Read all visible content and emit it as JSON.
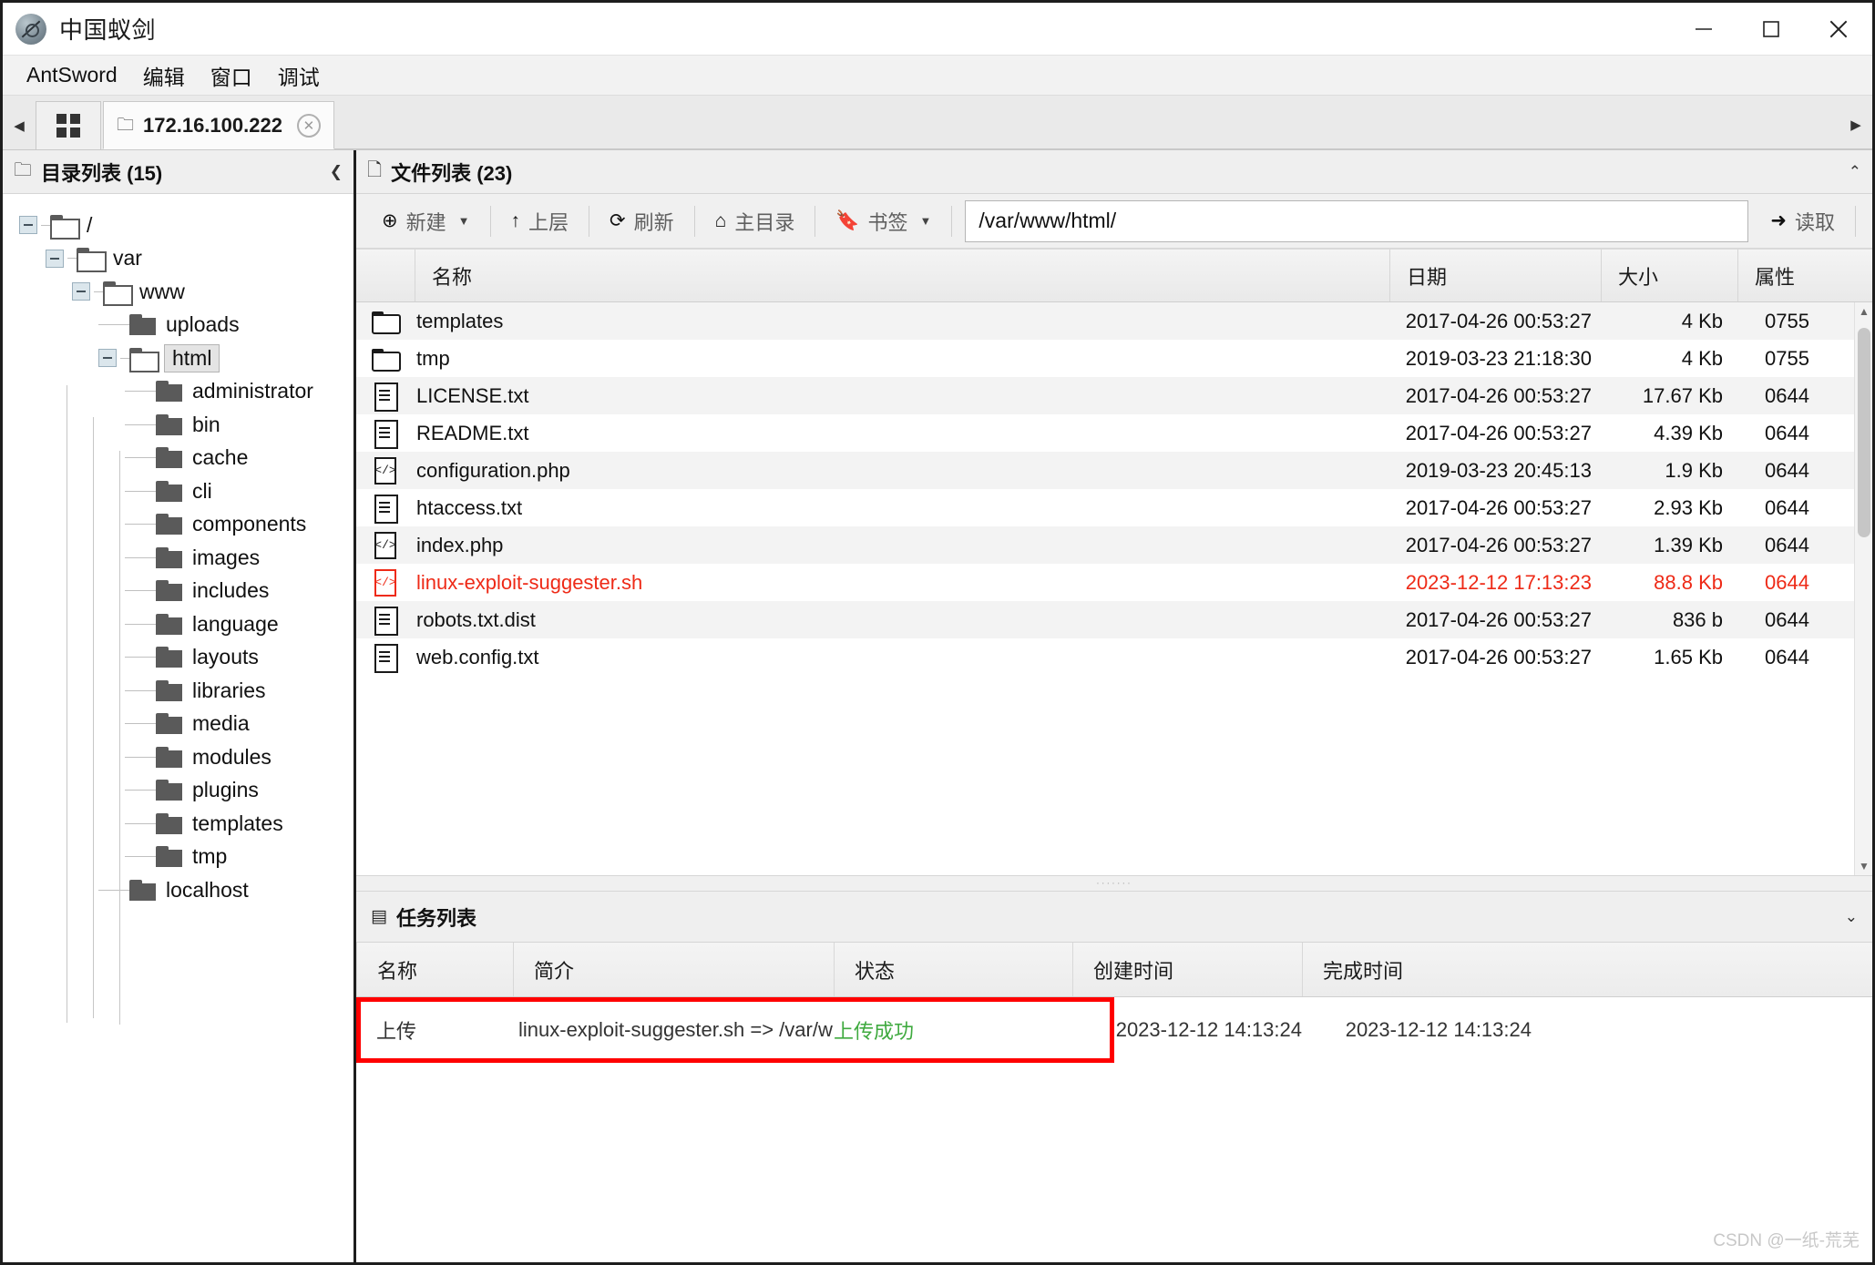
{
  "window": {
    "title": "中国蚁剑",
    "logo_icon": "antsword-logo-icon",
    "minimize_label": "—",
    "maximize_label": "□",
    "close_label": "✕"
  },
  "menubar": {
    "items": [
      {
        "label": "AntSword"
      },
      {
        "label": "编辑"
      },
      {
        "label": "窗口"
      },
      {
        "label": "调试"
      }
    ]
  },
  "tabbar": {
    "scroll_left_icon": "chevron-left-icon",
    "grid_button_icon": "grid-icon",
    "tab": {
      "folder_icon": "folder-icon",
      "label": "172.16.100.222",
      "close_icon": "close-circle-icon"
    },
    "scroll_right_icon": "chevron-right-icon"
  },
  "sidebar": {
    "header": {
      "icon": "folder-icon",
      "title": "目录列表 (15)",
      "collapse_icon": "chevron-left-icon"
    },
    "tree": [
      {
        "label": "/",
        "depth": 0,
        "expandable": true,
        "icon": "folder-open-icon"
      },
      {
        "label": "var",
        "depth": 1,
        "expandable": true,
        "icon": "folder-open-icon"
      },
      {
        "label": "www",
        "depth": 2,
        "expandable": true,
        "icon": "folder-open-icon"
      },
      {
        "label": "uploads",
        "depth": 3,
        "expandable": false,
        "icon": "folder-solid-icon"
      },
      {
        "label": "html",
        "depth": 3,
        "expandable": true,
        "icon": "folder-open-icon",
        "selected": true
      },
      {
        "label": "administrator",
        "depth": 4,
        "expandable": false,
        "icon": "folder-solid-icon"
      },
      {
        "label": "bin",
        "depth": 4,
        "expandable": false,
        "icon": "folder-solid-icon"
      },
      {
        "label": "cache",
        "depth": 4,
        "expandable": false,
        "icon": "folder-solid-icon"
      },
      {
        "label": "cli",
        "depth": 4,
        "expandable": false,
        "icon": "folder-solid-icon"
      },
      {
        "label": "components",
        "depth": 4,
        "expandable": false,
        "icon": "folder-solid-icon"
      },
      {
        "label": "images",
        "depth": 4,
        "expandable": false,
        "icon": "folder-solid-icon"
      },
      {
        "label": "includes",
        "depth": 4,
        "expandable": false,
        "icon": "folder-solid-icon"
      },
      {
        "label": "language",
        "depth": 4,
        "expandable": false,
        "icon": "folder-solid-icon"
      },
      {
        "label": "layouts",
        "depth": 4,
        "expandable": false,
        "icon": "folder-solid-icon"
      },
      {
        "label": "libraries",
        "depth": 4,
        "expandable": false,
        "icon": "folder-solid-icon"
      },
      {
        "label": "media",
        "depth": 4,
        "expandable": false,
        "icon": "folder-solid-icon"
      },
      {
        "label": "modules",
        "depth": 4,
        "expandable": false,
        "icon": "folder-solid-icon"
      },
      {
        "label": "plugins",
        "depth": 4,
        "expandable": false,
        "icon": "folder-solid-icon"
      },
      {
        "label": "templates",
        "depth": 4,
        "expandable": false,
        "icon": "folder-solid-icon"
      },
      {
        "label": "tmp",
        "depth": 4,
        "expandable": false,
        "icon": "folder-solid-icon"
      },
      {
        "label": "localhost",
        "depth": 3,
        "expandable": false,
        "icon": "folder-solid-icon"
      }
    ]
  },
  "filepane": {
    "header": {
      "collapse_icon": "chevron-left-icon",
      "icon": "file-icon",
      "title": "文件列表 (23)",
      "expand_icon": "chevron-up-icon"
    },
    "toolbar": {
      "new_label": "新建",
      "new_icon": "plus-circle-icon",
      "new_caret_icon": "caret-down-icon",
      "up_label": "上层",
      "up_icon": "arrow-up-icon",
      "refresh_label": "刷新",
      "refresh_icon": "refresh-icon",
      "home_label": "主目录",
      "home_icon": "home-icon",
      "bookmark_label": "书签",
      "bookmark_icon": "bookmark-icon",
      "bookmark_caret_icon": "caret-down-icon",
      "path_value": "/var/www/html/",
      "path_placeholder": "/var/www/html/",
      "read_label": "读取",
      "read_icon": "arrow-right-icon"
    },
    "columns": [
      "名称",
      "日期",
      "大小",
      "属性"
    ],
    "rows": [
      {
        "icon": "folder-icon",
        "name": "templates",
        "date": "2017-04-26 00:53:27",
        "size": "4 Kb",
        "attr": "0755",
        "highlight": false
      },
      {
        "icon": "folder-icon",
        "name": "tmp",
        "date": "2019-03-23 21:18:30",
        "size": "4 Kb",
        "attr": "0755",
        "highlight": false
      },
      {
        "icon": "doc-icon",
        "name": "LICENSE.txt",
        "date": "2017-04-26 00:53:27",
        "size": "17.67 Kb",
        "attr": "0644",
        "highlight": false
      },
      {
        "icon": "doc-icon",
        "name": "README.txt",
        "date": "2017-04-26 00:53:27",
        "size": "4.39 Kb",
        "attr": "0644",
        "highlight": false
      },
      {
        "icon": "code-icon",
        "name": "configuration.php",
        "date": "2019-03-23 20:45:13",
        "size": "1.9 Kb",
        "attr": "0644",
        "highlight": false
      },
      {
        "icon": "doc-icon",
        "name": "htaccess.txt",
        "date": "2017-04-26 00:53:27",
        "size": "2.93 Kb",
        "attr": "0644",
        "highlight": false
      },
      {
        "icon": "code-icon",
        "name": "index.php",
        "date": "2017-04-26 00:53:27",
        "size": "1.39 Kb",
        "attr": "0644",
        "highlight": false
      },
      {
        "icon": "code-icon",
        "name": "linux-exploit-suggester.sh",
        "date": "2023-12-12 17:13:23",
        "size": "88.8 Kb",
        "attr": "0644",
        "highlight": true
      },
      {
        "icon": "doc-icon",
        "name": "robots.txt.dist",
        "date": "2017-04-26 00:53:27",
        "size": "836 b",
        "attr": "0644",
        "highlight": false
      },
      {
        "icon": "doc-icon",
        "name": "web.config.txt",
        "date": "2017-04-26 00:53:27",
        "size": "1.65 Kb",
        "attr": "0644",
        "highlight": false
      }
    ]
  },
  "tasklist": {
    "header": {
      "icon": "list-icon",
      "title": "任务列表",
      "toggle_icon": "chevron-down-icon"
    },
    "columns": [
      "名称",
      "简介",
      "状态",
      "创建时间",
      "完成时间"
    ],
    "rows": [
      {
        "name": "上传",
        "desc": "linux-exploit-suggester.sh => /var/w",
        "state": "上传成功",
        "created": "2023-12-12 14:13:24",
        "finished": "2023-12-12 14:13:24"
      }
    ]
  },
  "colors": {
    "highlight_red": "#ee2a17",
    "annotation_red": "#ff0000",
    "success_green": "#3faa3f"
  },
  "watermark": "CSDN @一纸-荒芜"
}
